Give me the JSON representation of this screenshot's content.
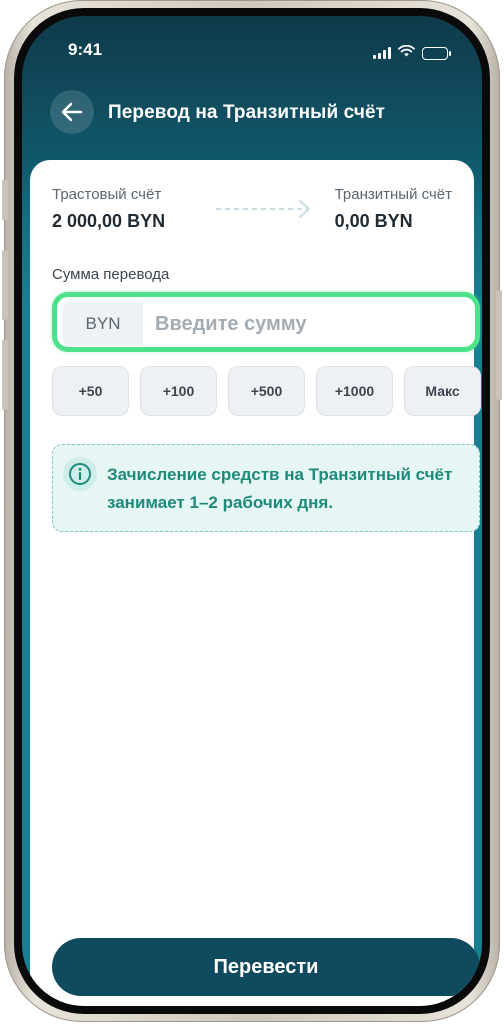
{
  "status_bar": {
    "time": "9:41",
    "icons": [
      "signal-icon",
      "wifi-icon",
      "battery-icon"
    ]
  },
  "header": {
    "back_icon": "arrow-left-icon",
    "title": "Перевод на Транзитный счёт"
  },
  "transfer": {
    "from": {
      "label": "Трастовый счёт",
      "value": "2 000,00 BYN"
    },
    "to": {
      "label": "Транзитный счёт",
      "value": "0,00 BYN"
    },
    "arrow_icon": "arrow-right-icon"
  },
  "amount": {
    "label": "Сумма перевода",
    "currency": "BYN",
    "value": "",
    "placeholder": "Введите сумму"
  },
  "quick_amounts": [
    "+50",
    "+100",
    "+500",
    "+1000",
    "Макс"
  ],
  "info": {
    "icon": "info-icon",
    "text": "Зачисление средств на Транзитный счёт занимает 1–2 рабочих дня."
  },
  "submit_label": "Перевести",
  "colors": {
    "header_bg": "#10576a",
    "highlight": "#4de28a",
    "info_text": "#1e8a7a",
    "button_bg": "#0f4a5e"
  }
}
